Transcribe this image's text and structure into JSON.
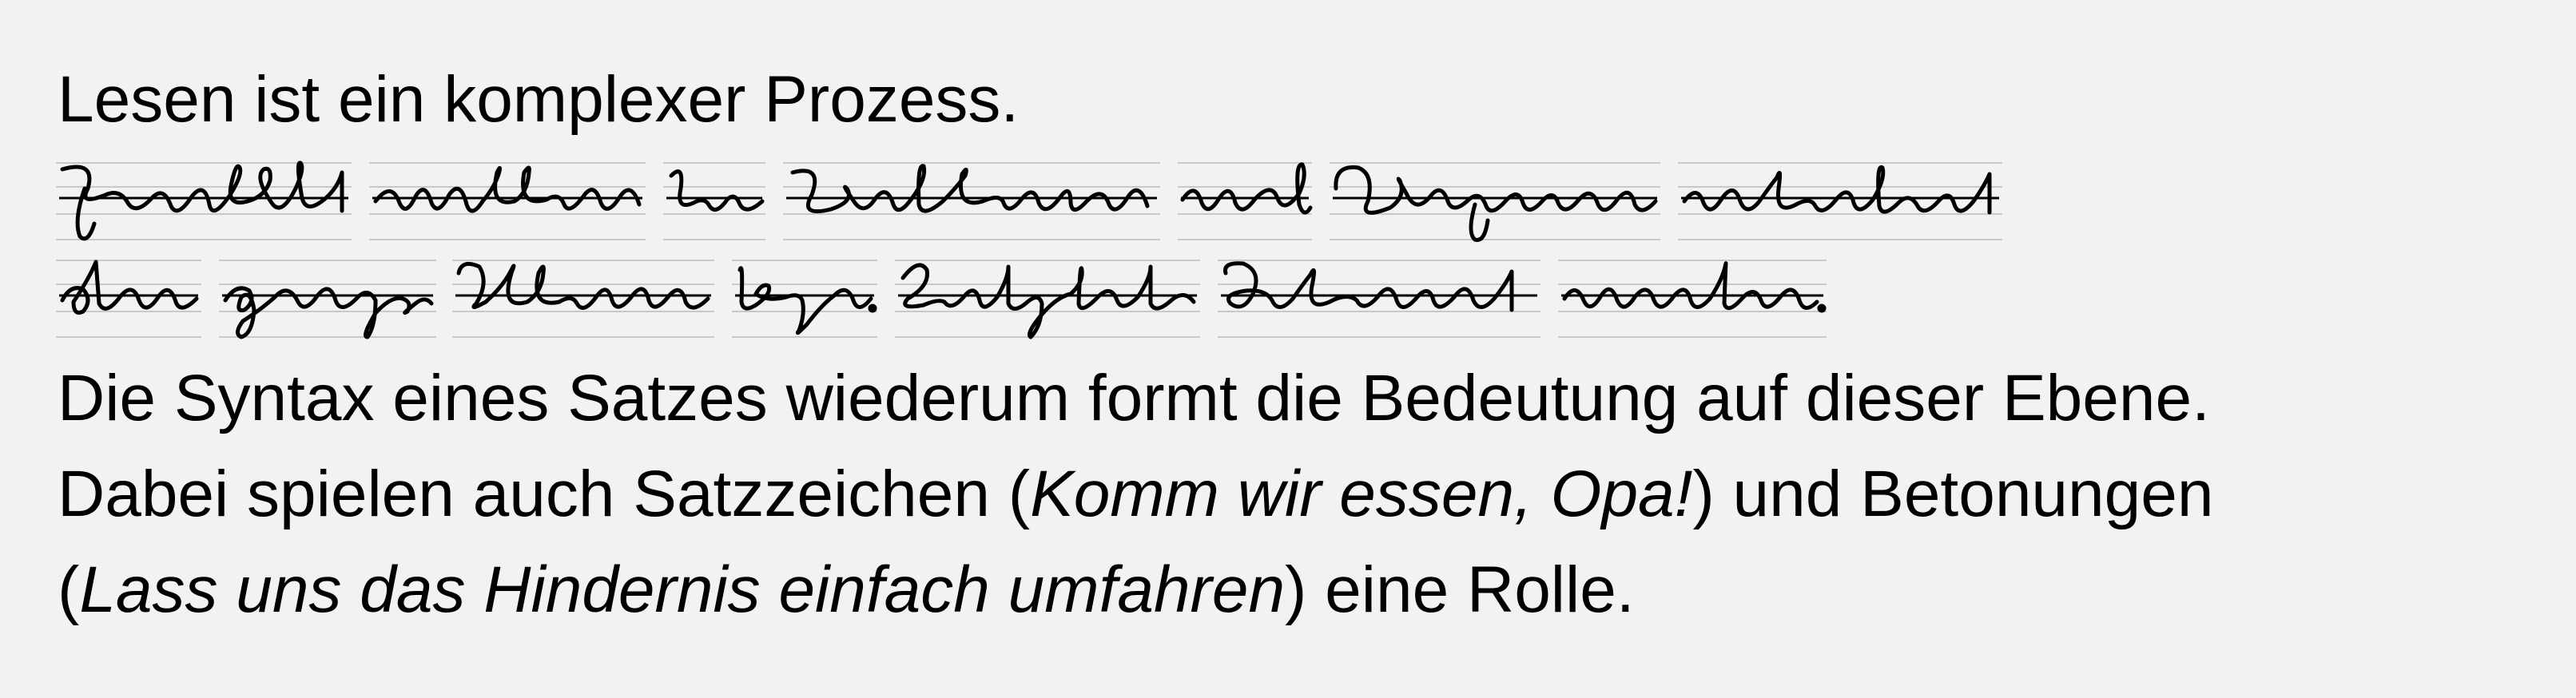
{
  "lines": {
    "l1": "Lesen ist ein komplexer Prozess.",
    "l4": "Die Syntax eines Satzes wiederum formt die Bedeutung auf dieser Ebene.",
    "l5_a": "Dabei spielen auch Satzzeichen (",
    "l5_b": "Komm wir essen, Opa!",
    "l5_c": ") und Betonungen",
    "l6_a": "(",
    "l6_b": "Lass uns das Hindernis einfach umfahren",
    "l6_c": ") eine Rolle."
  },
  "script": {
    "row1": [
      "Zunächst",
      "müssen",
      "die",
      "Buchstaben",
      "und",
      "Graphem",
      "erkannt"
    ],
    "row2": [
      "oder",
      "ganze",
      "Wörter",
      "bzw.",
      "Satzteile",
      "dekodiert",
      "werden."
    ]
  }
}
